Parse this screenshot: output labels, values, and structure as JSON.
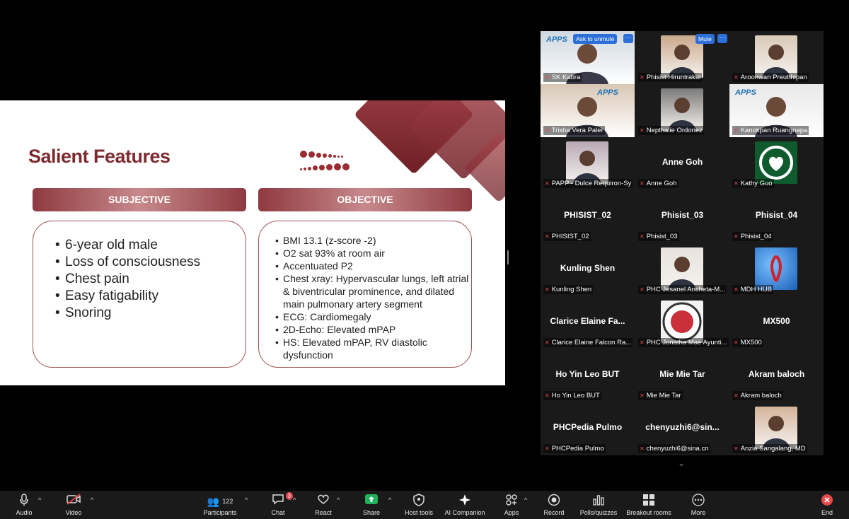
{
  "slide": {
    "title": "Salient Features",
    "subjective": {
      "header": "SUBJECTIVE",
      "items": [
        "6-year old male",
        "Loss of consciousness",
        "Chest pain",
        "Easy fatigability",
        "Snoring"
      ]
    },
    "objective": {
      "header": "OBJECTIVE",
      "items": [
        "BMI 13.1 (z-score -2)",
        "O2 sat 93% at room air",
        "Accentuated P2",
        "Chest xray: Hypervascular lungs,  left atrial & biventricular prominence, and dilated main pulmonary artery segment",
        "ECG: Cardiomegaly",
        "2D-Echo: Elevated mPAP",
        "HS: Elevated mPAP, RV diastolic dysfunction"
      ]
    }
  },
  "gallery": {
    "ask_to_unmute": "Ask to unmute",
    "mute": "Mute",
    "more": "···",
    "tiles": [
      {
        "name": "SK Kabra",
        "big": "",
        "pic": "video",
        "color": "#cfd8e0",
        "logo": "APPS"
      },
      {
        "name": "Phisist Hiruntrakul",
        "big": "",
        "pic": "photo",
        "color": "#c9a88a"
      },
      {
        "name": "Aroonwan Preutthipan",
        "big": "",
        "pic": "photo",
        "color": "#d8c9b8"
      },
      {
        "name": "Trisha Vera Paler",
        "big": "",
        "pic": "video",
        "color": "#d9c7b5",
        "logo": "APPS"
      },
      {
        "name": "Nepthalie Ordonez",
        "big": "",
        "pic": "photo",
        "color": "#7a7a7a"
      },
      {
        "name": "Kanokpan Ruangnapa",
        "big": "",
        "pic": "video",
        "color": "#e8e8ea",
        "logo": "APPS"
      },
      {
        "name": "PAPP - Dulce Requiron-Sy",
        "big": "",
        "pic": "photo",
        "color": "#b8a9b5"
      },
      {
        "name": "Anne Goh",
        "big": "Anne Goh",
        "pic": ""
      },
      {
        "name": "Kathy Guo",
        "big": "",
        "pic": "logo-green",
        "color": "#0f5b2e"
      },
      {
        "name": "PHISIST_02",
        "big": "PHISIST_02",
        "pic": ""
      },
      {
        "name": "Phisist_03",
        "big": "Phisist_03",
        "pic": ""
      },
      {
        "name": "Phisist_04",
        "big": "Phisist_04",
        "pic": ""
      },
      {
        "name": "Kunling Shen",
        "big": "Kunling Shen",
        "pic": ""
      },
      {
        "name": "PHC Jesanel Ancheta-M...",
        "big": "",
        "pic": "photo",
        "color": "#e7e2dc"
      },
      {
        "name": "MDH HUB",
        "big": "",
        "pic": "globe",
        "color": "#2f7dd6"
      },
      {
        "name": "Clarice Elaine Falcon Ra...",
        "big": "Clarice  Elaine  Fa...",
        "pic": ""
      },
      {
        "name": "PHC Jonatha Mae Ayunti...",
        "big": "",
        "pic": "seal",
        "color": "#f2f2f2"
      },
      {
        "name": "MX500",
        "big": "MX500",
        "pic": ""
      },
      {
        "name": "Ho Yin Leo BUT",
        "big": "Ho Yin Leo BUT",
        "pic": ""
      },
      {
        "name": "Mie Mie Tar",
        "big": "Mie Mie Tar",
        "pic": ""
      },
      {
        "name": "Akram baloch",
        "big": "Akram baloch",
        "pic": ""
      },
      {
        "name": "PHCPedia Pulmo",
        "big": "PHCPedia Pulmo",
        "pic": ""
      },
      {
        "name": "chenyuzhi6@sina.cn",
        "big": "chenyuzhi6@sin...",
        "pic": ""
      },
      {
        "name": "Anzia Sangalang, MD",
        "big": "",
        "pic": "photo",
        "color": "#d4b49b"
      }
    ]
  },
  "toolbar": {
    "audio": "Audio",
    "video": "Video",
    "participants": "Participants",
    "participants_count": "122",
    "chat": "Chat",
    "chat_badge": "3",
    "react": "React",
    "share": "Share",
    "host_tools": "Host tools",
    "ai_companion": "AI Companion",
    "apps": "Apps",
    "record": "Record",
    "polls": "Polls/quizzes",
    "breakout": "Breakout rooms",
    "more": "More",
    "end": "End"
  },
  "colors": {
    "accent_red": "#7d2a30",
    "active_speaker": "#35c45a",
    "share_green": "#1fb25a",
    "end_red": "#e5484d",
    "hover_blue": "#2c6fd9"
  }
}
